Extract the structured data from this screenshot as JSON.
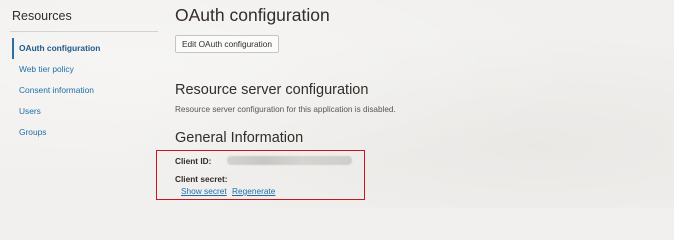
{
  "sidebar": {
    "title": "Resources",
    "items": [
      {
        "label": "OAuth configuration",
        "active": true
      },
      {
        "label": "Web tier policy",
        "active": false
      },
      {
        "label": "Consent information",
        "active": false
      },
      {
        "label": "Users",
        "active": false
      },
      {
        "label": "Groups",
        "active": false
      }
    ]
  },
  "main": {
    "title": "OAuth configuration",
    "edit_button_label": "Edit OAuth configuration",
    "resource_server": {
      "heading": "Resource server configuration",
      "description": "Resource server configuration for this application is disabled."
    },
    "general_information": {
      "heading": "General Information",
      "client_id_label": "Client ID:",
      "client_secret_label": "Client secret:",
      "show_secret_label": "Show secret",
      "regenerate_label": "Regenerate"
    }
  },
  "colors": {
    "background": "#f1f0ee",
    "text": "#312d2a",
    "link": "#1e6fa8",
    "active_indicator": "#2d6fa3",
    "highlight_box": "#c4161c"
  }
}
